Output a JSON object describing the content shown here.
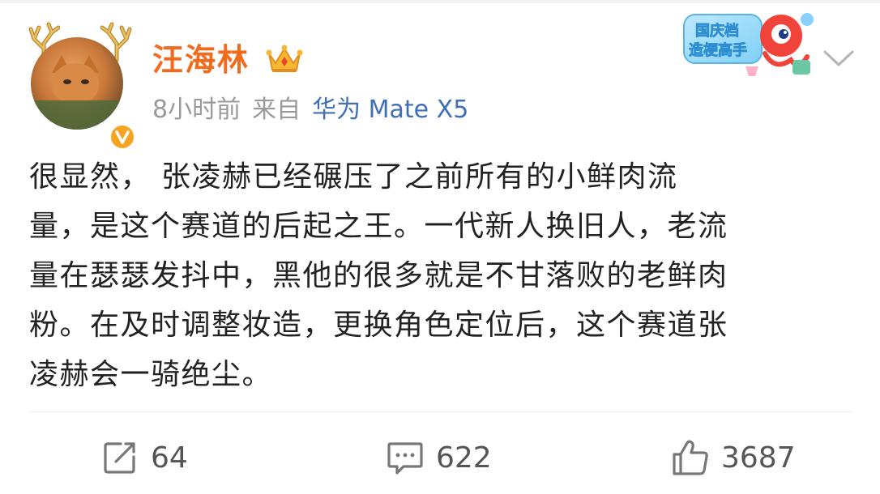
{
  "post": {
    "author": "汪海林",
    "time": "8小时前",
    "source_prefix": "来自",
    "device": "华为 Mate X5",
    "text_lines": [
      "很显然， 张凌赫已经碾压了之前所有的小鲜肉流",
      "量，是这个赛道的后起之王。一代新人换旧人，老流",
      "量在瑟瑟发抖中，黑他的很多就是不甘落败的老鲜肉",
      "粉。在及时调整妆造，更换角色定位后，这个赛道张",
      "凌赫会一骑绝尘。"
    ]
  },
  "badge": {
    "line1": "国庆档",
    "line2": "造梗高手"
  },
  "actions": {
    "repost_count": "64",
    "comment_count": "622",
    "like_count": "3687"
  },
  "icons": {
    "avatar": "cat-avatar",
    "verified": "verified-badge-icon",
    "crown": "crown-icon",
    "chevron": "chevron-down-icon",
    "repost": "repost-icon",
    "comment": "comment-icon",
    "like": "like-icon"
  },
  "colors": {
    "author": "#f26b1d",
    "device": "#3f6fb6",
    "meta": "#9a9a9a",
    "text": "#222222",
    "verified": "#f7a520"
  }
}
